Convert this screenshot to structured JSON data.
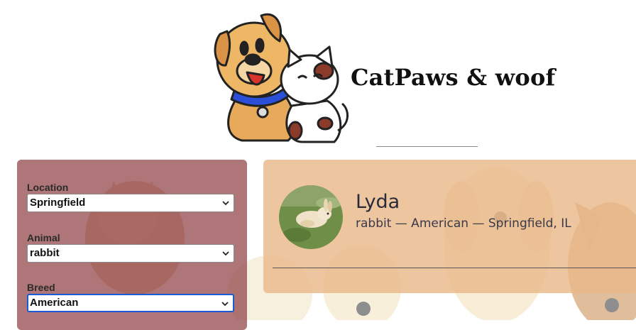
{
  "brand": {
    "name": "CatPaws & woof"
  },
  "search": {
    "fields": [
      {
        "label": "Location",
        "value": "Springfield"
      },
      {
        "label": "Animal",
        "value": "rabbit"
      },
      {
        "label": "Breed",
        "value": "American"
      }
    ]
  },
  "results": [
    {
      "name": "Lyda",
      "details": "rabbit — American — Springfield, IL"
    }
  ],
  "colors": {
    "panel": "#8c3c3e",
    "card": "#e8b888",
    "focus": "#1a5bd6"
  },
  "icons": {
    "select_arrow": "chevron-down-icon",
    "logo": "cat-and-dog-logo"
  }
}
